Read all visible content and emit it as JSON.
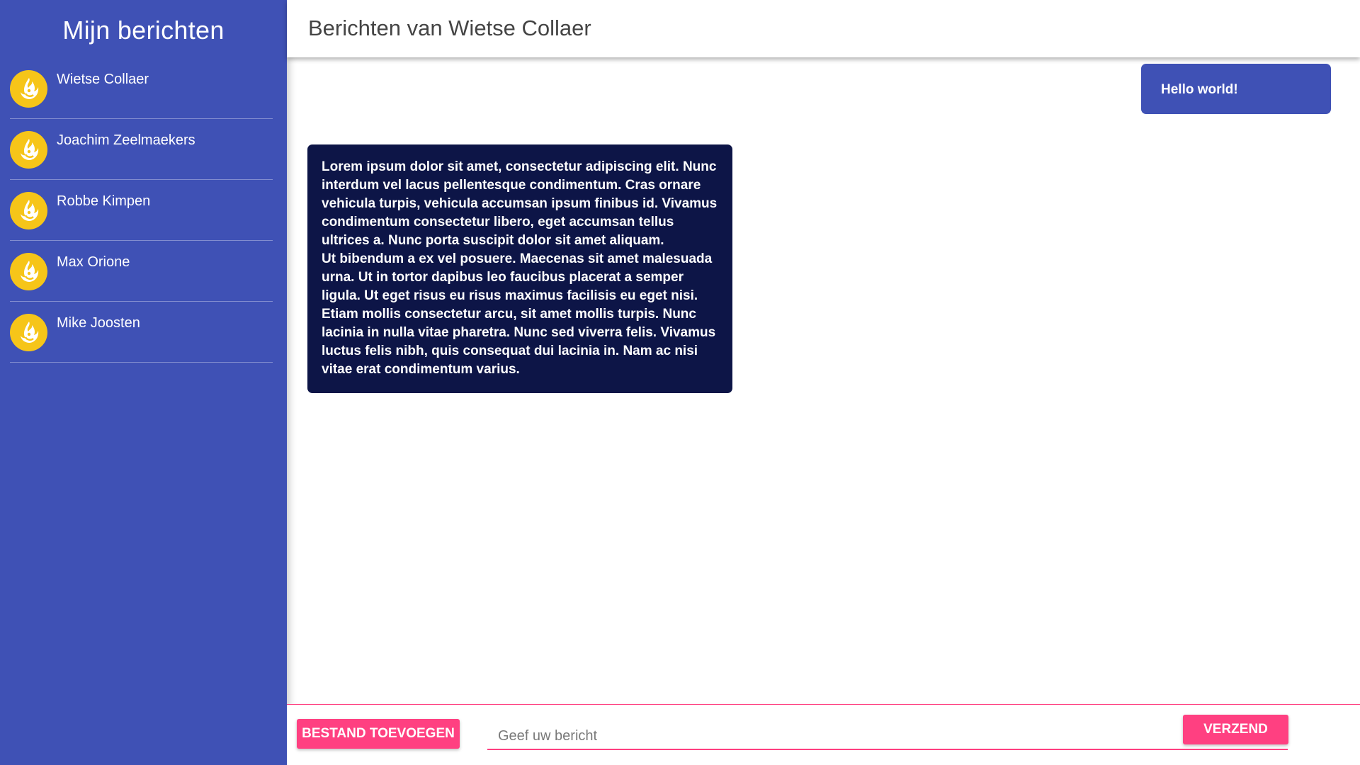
{
  "sidebar": {
    "title": "Mijn berichten",
    "contacts": [
      {
        "name": "Wietse Collaer",
        "avatar_icon": "flame-avatar-icon"
      },
      {
        "name": "Joachim Zeelmaekers",
        "avatar_icon": "flame-avatar-icon"
      },
      {
        "name": "Robbe Kimpen",
        "avatar_icon": "flame-avatar-icon"
      },
      {
        "name": "Max Orione",
        "avatar_icon": "flame-avatar-icon"
      },
      {
        "name": "Mike Joosten",
        "avatar_icon": "flame-avatar-icon"
      }
    ]
  },
  "header": {
    "title": "Berichten van Wietse Collaer"
  },
  "messages": {
    "outgoing": [
      {
        "text": "Hello world!"
      }
    ],
    "incoming": [
      {
        "paragraphs": [
          "Lorem ipsum dolor sit amet, consectetur adipiscing elit. Nunc interdum vel lacus pellentesque condimentum. Cras ornare vehicula turpis, vehicula accumsan ipsum finibus id. Vivamus condimentum consectetur libero, eget accumsan tellus ultrices a. Nunc porta suscipit dolor sit amet aliquam.",
          "Ut bibendum a ex vel posuere. Maecenas sit amet malesuada urna. Ut in tortor dapibus leo faucibus placerat a semper ligula. Ut eget risus eu risus maximus facilisis eu eget nisi. Etiam mollis consectetur arcu, sit amet mollis turpis. Nunc lacinia in nulla vitae pharetra. Nunc sed viverra felis. Vivamus luctus felis nibh, quis consequat dui lacinia in. Nam ac nisi vitae erat condimentum varius."
        ]
      }
    ]
  },
  "compose": {
    "attach_label": "BESTAND TOEVOEGEN",
    "input_placeholder": "Geef uw bericht",
    "input_value": "",
    "send_label": "VERZEND"
  },
  "colors": {
    "sidebar_bg": "#3f51b5",
    "outgoing_bubble": "#3f51b5",
    "incoming_bubble": "#0d1547",
    "accent": "#ff4081",
    "avatar_bg": "#f6c519"
  }
}
